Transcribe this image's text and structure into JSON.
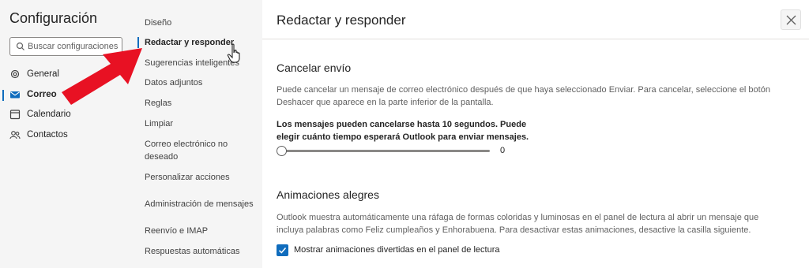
{
  "app": {
    "title": "Configuración"
  },
  "search": {
    "placeholder": "Buscar configuraciones"
  },
  "nav": [
    {
      "label": "General",
      "icon": "gear-icon"
    },
    {
      "label": "Correo",
      "icon": "mail-icon",
      "active": true
    },
    {
      "label": "Calendario",
      "icon": "calendar-icon"
    },
    {
      "label": "Contactos",
      "icon": "people-icon"
    }
  ],
  "subnav": [
    {
      "label": "Diseño"
    },
    {
      "label": "Redactar y responder",
      "active": true
    },
    {
      "label": "Sugerencias inteligentes"
    },
    {
      "label": "Datos adjuntos"
    },
    {
      "label": "Reglas"
    },
    {
      "label": "Limpiar"
    },
    {
      "label": "Correo electrónico no deseado"
    },
    {
      "label": "Personalizar acciones"
    },
    {
      "label": "Administración de mensajes"
    },
    {
      "label": "Reenvío e IMAP"
    },
    {
      "label": "Respuestas automáticas"
    }
  ],
  "panel": {
    "title": "Redactar y responder",
    "undo_send": {
      "heading": "Cancelar envío",
      "description": "Puede cancelar un mensaje de correo electrónico después de que haya seleccionado Enviar. Para cancelar, seleccione el botón Deshacer que aparece en la parte inferior de la pantalla.",
      "note": "Los mensajes pueden cancelarse hasta 10 segundos. Puede elegir cuánto tiempo esperará Outlook para enviar mensajes.",
      "slider_value": "0"
    },
    "animations": {
      "heading": "Animaciones alegres",
      "description": "Outlook muestra automáticamente una ráfaga de formas coloridas y luminosas en el panel de lectura al abrir un mensaje que incluya palabras como Feliz cumpleaños y Enhorabuena. Para desactivar estas animaciones, desactive la casilla siguiente.",
      "checkbox_label": "Mostrar animaciones divertidas en el panel de lectura",
      "checked": true
    }
  },
  "colors": {
    "accent": "#0f6cbd",
    "arrow": "#e81123"
  }
}
